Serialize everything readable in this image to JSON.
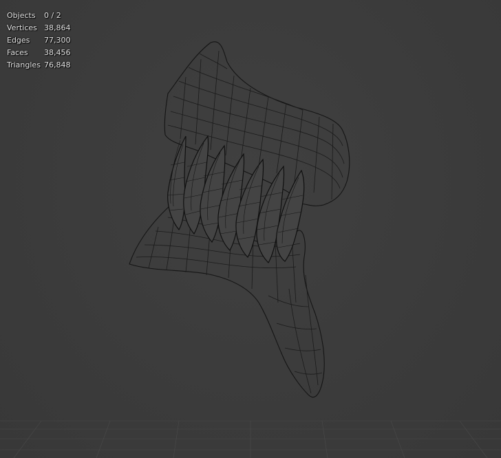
{
  "overlay": {
    "stats": [
      {
        "label": "Objects",
        "value": "0 / 2"
      },
      {
        "label": "Vertices",
        "value": "38,864"
      },
      {
        "label": "Edges",
        "value": "77,300"
      },
      {
        "label": "Faces",
        "value": "38,456"
      },
      {
        "label": "Triangles",
        "value": "76,848"
      }
    ]
  },
  "viewport": {
    "background_color": "#3d3d3d",
    "wire_color": "#141414",
    "shading": "wireframe",
    "object": "jaw-with-teeth-mesh"
  }
}
